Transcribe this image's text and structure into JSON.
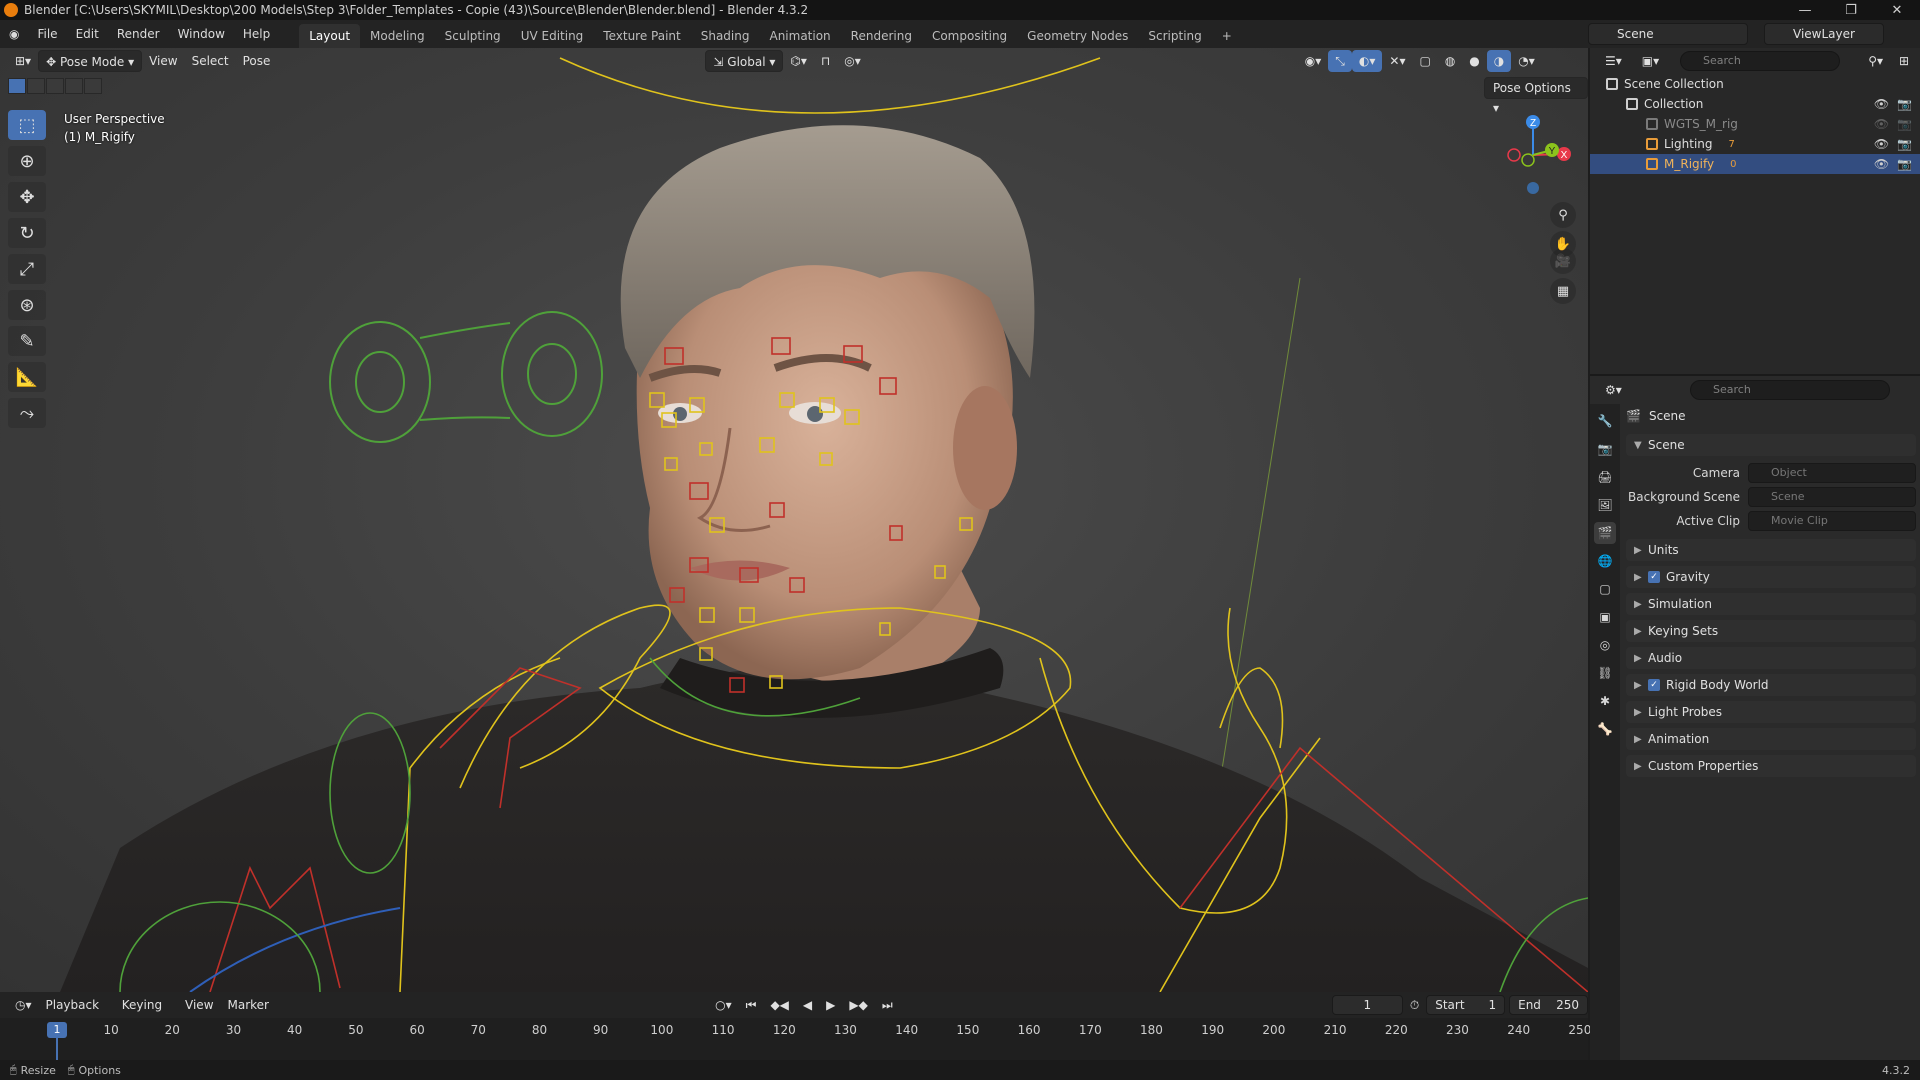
{
  "window": {
    "title": "Blender [C:\\Users\\SKYMIL\\Desktop\\200 Models\\Step 3\\Folder_Templates - Copie (43)\\Source\\Blender\\Blender.blend] - Blender 4.3.2",
    "minimize": "—",
    "maximize": "❐",
    "close": "✕"
  },
  "menu": {
    "items": [
      "File",
      "Edit",
      "Render",
      "Window",
      "Help"
    ],
    "workspaces": [
      "Layout",
      "Modeling",
      "Sculpting",
      "UV Editing",
      "Texture Paint",
      "Shading",
      "Animation",
      "Rendering",
      "Compositing",
      "Geometry Nodes",
      "Scripting",
      "+"
    ],
    "scene": "Scene",
    "view_layer": "ViewLayer"
  },
  "viewport": {
    "mode": "Pose Mode",
    "menus": [
      "View",
      "Select",
      "Pose"
    ],
    "orientation": "Global",
    "pose_options": "Pose Options",
    "perspective": "User Perspective",
    "active_object": "(1) M_Rigify",
    "gizmo_axes": [
      "X",
      "Y",
      "Z"
    ]
  },
  "timeline": {
    "menus": [
      "Playback",
      "Keying",
      "View",
      "Marker"
    ],
    "current_frame": "1",
    "start_label": "Start",
    "start": "1",
    "end_label": "End",
    "end": "250",
    "ruler": [
      "1",
      "10",
      "20",
      "30",
      "40",
      "50",
      "60",
      "70",
      "80",
      "90",
      "100",
      "110",
      "120",
      "130",
      "140",
      "150",
      "160",
      "170",
      "180",
      "190",
      "200",
      "210",
      "220",
      "230",
      "240",
      "250"
    ]
  },
  "outliner": {
    "search_placeholder": "Search",
    "rows": [
      {
        "label": "Scene Collection",
        "indent": 0,
        "type": "scene"
      },
      {
        "label": "Collection",
        "indent": 1,
        "type": "collection"
      },
      {
        "label": "WGTS_M_rig",
        "indent": 2,
        "type": "collection-dim"
      },
      {
        "label": "Lighting",
        "indent": 2,
        "type": "lighting",
        "badge": "7"
      },
      {
        "label": "M_Rigify",
        "indent": 2,
        "type": "armature",
        "badge": "0"
      }
    ]
  },
  "properties": {
    "search_placeholder": "Search",
    "context": "Scene",
    "panel_title": "Scene",
    "fields": [
      {
        "label": "Camera",
        "placeholder": "Object"
      },
      {
        "label": "Background Scene",
        "placeholder": "Scene"
      },
      {
        "label": "Active Clip",
        "placeholder": "Movie Clip"
      }
    ],
    "panels": [
      {
        "label": "Units",
        "checkbox": false
      },
      {
        "label": "Gravity",
        "checkbox": true
      },
      {
        "label": "Simulation",
        "checkbox": false
      },
      {
        "label": "Keying Sets",
        "checkbox": false
      },
      {
        "label": "Audio",
        "checkbox": false
      },
      {
        "label": "Rigid Body World",
        "checkbox": true
      },
      {
        "label": "Light Probes",
        "checkbox": false
      },
      {
        "label": "Animation",
        "checkbox": false
      },
      {
        "label": "Custom Properties",
        "checkbox": false
      }
    ]
  },
  "status": {
    "resize": "Resize",
    "options": "Options",
    "version": "4.3.2"
  },
  "colors": {
    "accent": "#4772b3",
    "selected_row": "#334d80",
    "bone_yellow": "#e0c31c",
    "bone_red": "#c0302a",
    "bone_green": "#4fa13a",
    "axis_x": "#e8394a",
    "axis_y": "#8bc21c",
    "axis_z": "#3b8be8"
  }
}
